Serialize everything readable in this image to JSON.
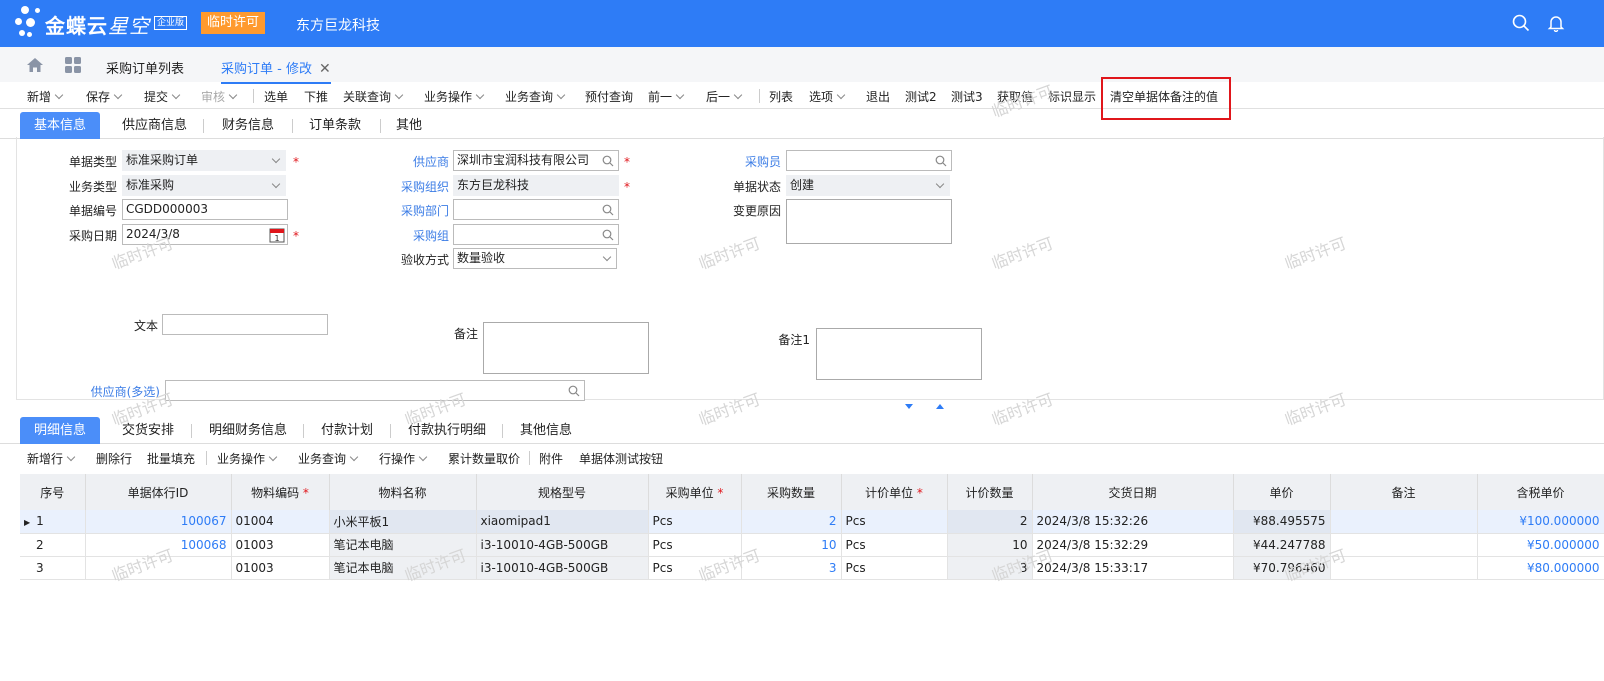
{
  "header": {
    "brand": "金蝶云",
    "brand_sub": "星空",
    "edition_badge": "企业版",
    "temp_license_button": "临时许可",
    "org_name": "东方巨龙科技"
  },
  "tabs": [
    {
      "label": "采购订单列表"
    },
    {
      "label": "采购订单 - 修改"
    }
  ],
  "toolbar": {
    "items": [
      "新增",
      "保存",
      "提交",
      "审核",
      "选单",
      "下推",
      "关联查询",
      "业务操作",
      "业务查询",
      "预付查询",
      "前一",
      "后一",
      "列表",
      "选项",
      "退出",
      "测试2",
      "测试3",
      "获取值",
      "标识显示",
      "清空单据体备注的值"
    ]
  },
  "head_tabs": [
    "基本信息",
    "供应商信息",
    "财务信息",
    "订单条款",
    "其他"
  ],
  "form": {
    "bill_type_label": "单据类型",
    "bill_type_value": "标准采购订单",
    "biz_type_label": "业务类型",
    "biz_type_value": "标准采购",
    "bill_no_label": "单据编号",
    "bill_no_value": "CGDD000003",
    "date_label": "采购日期",
    "date_value": "2024/3/8",
    "supplier_label": "供应商",
    "supplier_value": "深圳市宝润科技有限公司",
    "purchase_org_label": "采购组织",
    "purchase_org_value": "东方巨龙科技",
    "purchase_dept_label": "采购部门",
    "purchase_dept_value": "",
    "purchase_group_label": "采购组",
    "purchase_group_value": "",
    "accept_method_label": "验收方式",
    "accept_method_value": "数量验收",
    "buyer_label": "采购员",
    "buyer_value": "",
    "status_label": "单据状态",
    "status_value": "创建",
    "change_reason_label": "变更原因",
    "text_label": "文本",
    "text_value": "",
    "remark_label": "备注",
    "remark1_label": "备注1",
    "multi_supplier_label": "供应商(多选)"
  },
  "watermark": "临时许可",
  "entry_tabs": [
    "明细信息",
    "交货安排",
    "明细财务信息",
    "付款计划",
    "付款执行明细",
    "其他信息"
  ],
  "entry_toolbar": [
    "新增行",
    "删除行",
    "批量填充",
    "业务操作",
    "业务查询",
    "行操作",
    "累计数量取价",
    "附件",
    "单据体测试按钮"
  ],
  "grid": {
    "columns": [
      "序号",
      "单据体行ID",
      "物料编码",
      "物料名称",
      "规格型号",
      "采购单位",
      "采购数量",
      "计价单位",
      "计价数量",
      "交货日期",
      "单价",
      "备注",
      "含税单价"
    ],
    "rows": [
      {
        "seq": "1",
        "row_id": "100067",
        "material_code": "01004",
        "material_name": "小米平板1",
        "spec": "xiaomipad1",
        "unit": "Pcs",
        "qty": "2",
        "price_unit": "Pcs",
        "price_qty": "2",
        "delivery": "2024/3/8 15:32:26",
        "price": "¥88.495575",
        "remark": "",
        "tax_price": "¥100.000000"
      },
      {
        "seq": "2",
        "row_id": "100068",
        "material_code": "01003",
        "material_name": "笔记本电脑",
        "spec": "i3-10010-4GB-500GB",
        "unit": "Pcs",
        "qty": "10",
        "price_unit": "Pcs",
        "price_qty": "10",
        "delivery": "2024/3/8 15:32:29",
        "price": "¥44.247788",
        "remark": "",
        "tax_price": "¥50.000000"
      },
      {
        "seq": "3",
        "row_id": "",
        "material_code": "01003",
        "material_name": "笔记本电脑",
        "spec": "i3-10010-4GB-500GB",
        "unit": "Pcs",
        "qty": "3",
        "price_unit": "Pcs",
        "price_qty": "3",
        "delivery": "2024/3/8 15:33:17",
        "price": "¥70.796460",
        "remark": "",
        "tax_price": "¥80.000000"
      }
    ]
  },
  "colors": {
    "primary": "#2e7cf6",
    "temp": "#ff9a2e",
    "required": "#e0161b",
    "highlight": "#e0161b"
  },
  "icons": [
    "search-icon",
    "bell-icon",
    "home-icon",
    "apps-icon",
    "close-icon",
    "calendar-icon",
    "chevron-down-icon"
  ]
}
